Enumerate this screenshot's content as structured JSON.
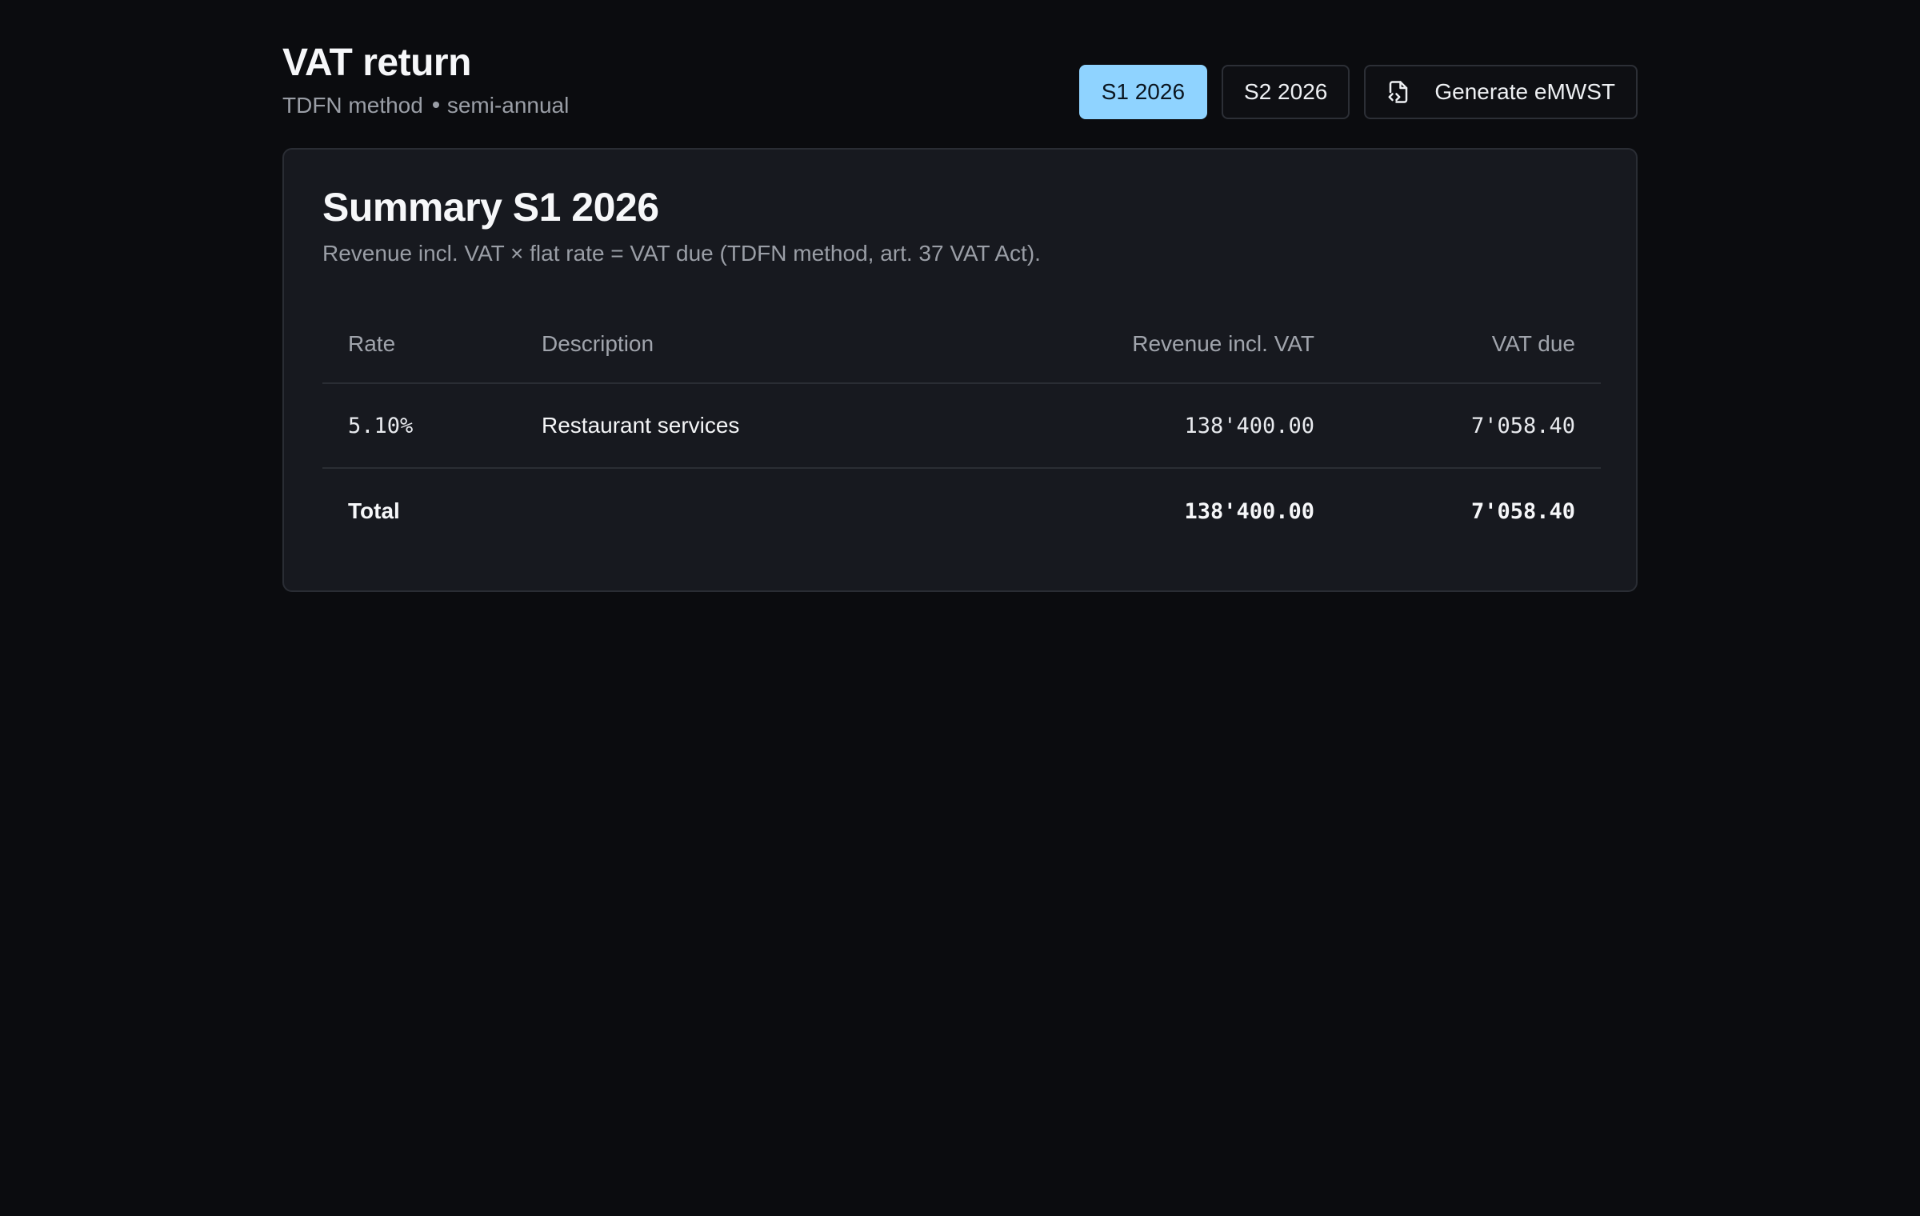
{
  "header": {
    "title": "VAT return",
    "subtitle_method": "TDFN method",
    "subtitle_period": "semi-annual"
  },
  "toolbar": {
    "periods": [
      {
        "label": "S1 2026",
        "active": true
      },
      {
        "label": "S2 2026",
        "active": false
      }
    ],
    "generate_label": "Generate eMWST",
    "generate_icon": "file-code-icon",
    "accent_color": "#8fd3ff"
  },
  "summary": {
    "title": "Summary S1 2026",
    "description": "Revenue incl. VAT × flat rate = VAT due (TDFN method, art. 37 VAT Act).",
    "columns": {
      "rate": "Rate",
      "description": "Description",
      "revenue": "Revenue incl. VAT",
      "vat_due": "VAT due"
    },
    "rows": [
      {
        "rate": "5.10%",
        "description": "Restaurant services",
        "revenue": "138'400.00",
        "vat_due": "7'058.40"
      }
    ],
    "total": {
      "label": "Total",
      "revenue": "138'400.00",
      "vat_due": "7'058.40"
    }
  }
}
